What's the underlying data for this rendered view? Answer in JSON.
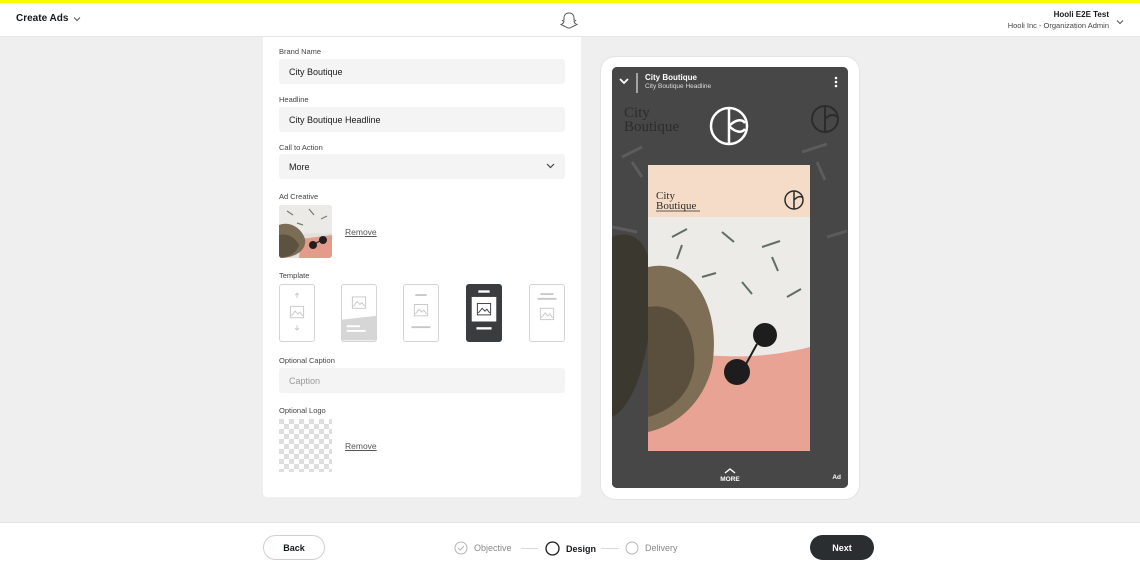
{
  "header": {
    "app_title": "Create Ads",
    "account_name": "Hooli E2E Test",
    "account_org": "Hooli Inc - Organization Admin"
  },
  "form": {
    "brand_name_label": "Brand Name",
    "brand_name_value": "City Boutique",
    "headline_label": "Headline",
    "headline_value": "City Boutique Headline",
    "cta_label": "Call to Action",
    "cta_value": "More",
    "ad_creative_label": "Ad Creative",
    "remove_label": "Remove",
    "template_label": "Template",
    "selected_template": 4,
    "caption_label": "Optional Caption",
    "caption_placeholder": "Caption",
    "logo_label": "Optional Logo"
  },
  "preview": {
    "brand": "City Boutique",
    "headline": "City Boutique Headline",
    "logo_text_line1": "City",
    "logo_text_line2": "Boutique",
    "more_label": "MORE",
    "ad_badge": "Ad"
  },
  "footer": {
    "back_label": "Back",
    "next_label": "Next",
    "steps": [
      {
        "label": "Objective",
        "state": "done"
      },
      {
        "label": "Design",
        "state": "active"
      },
      {
        "label": "Delivery",
        "state": "todo"
      }
    ]
  },
  "colors": {
    "accent_yellow": "#fffc00",
    "dark_button": "#2b2e31",
    "field_bg": "#f4f4f4",
    "preview_peach": "#f5dcc8",
    "preview_coral": "#e9a394"
  }
}
